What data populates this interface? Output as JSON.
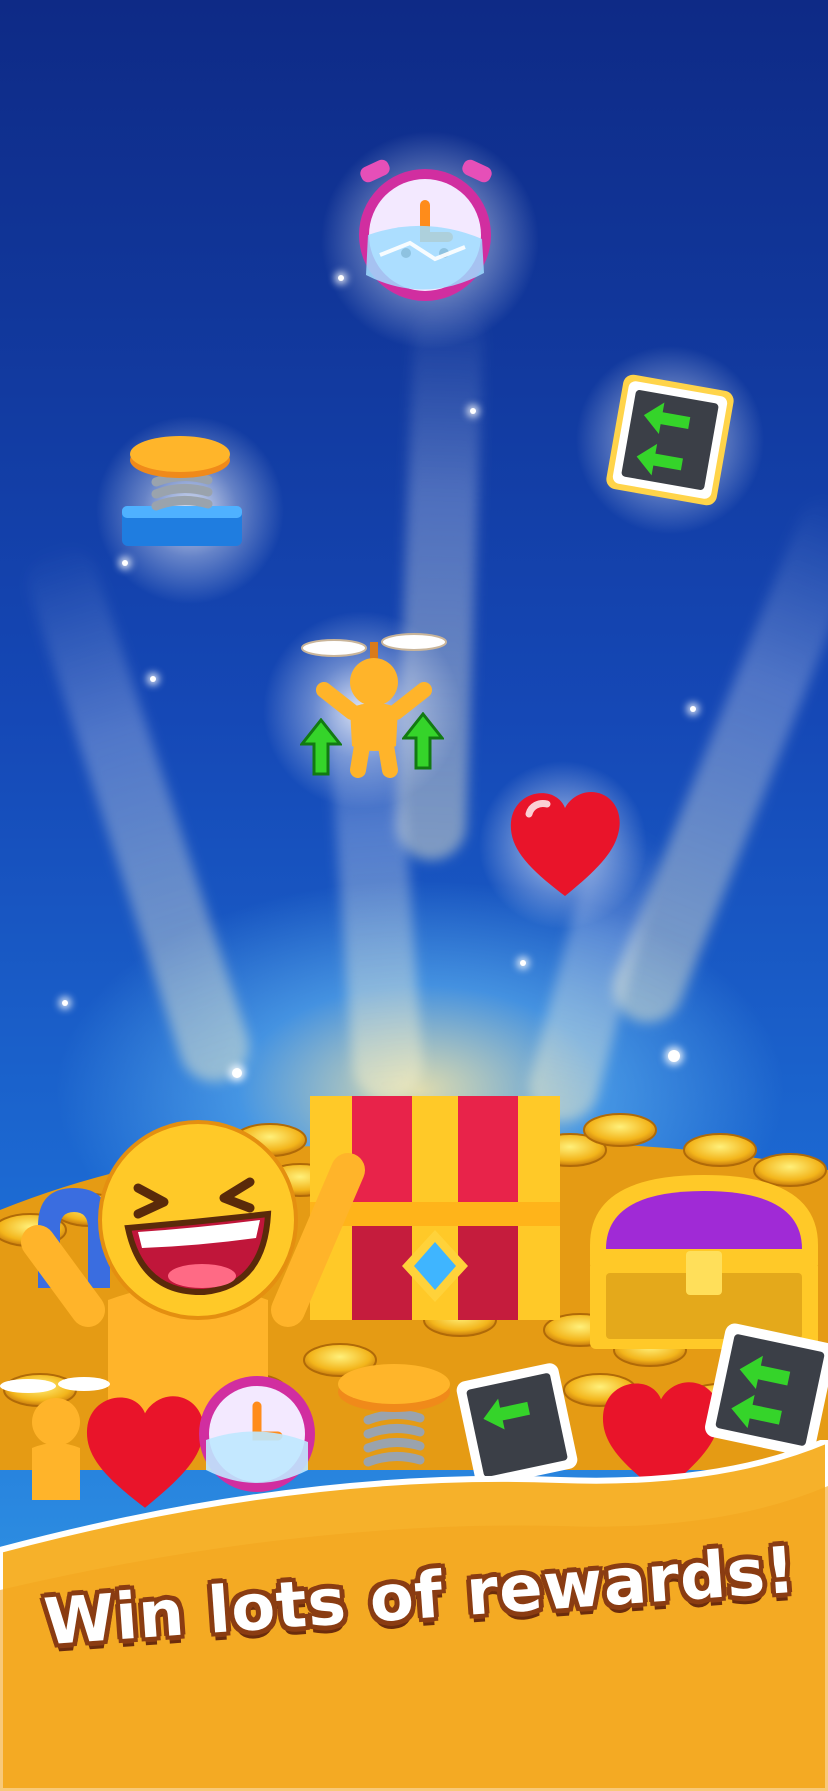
{
  "screen": {
    "banner": {
      "headline": "Win lots of rewards!"
    },
    "flying_rewards": [
      {
        "name": "freeze-clock",
        "icon": "frozen-alarm-clock-icon"
      },
      {
        "name": "undo-card",
        "icon": "double-left-arrow-card-icon"
      },
      {
        "name": "spring-booster",
        "icon": "spring-pad-icon"
      },
      {
        "name": "propeller-jump",
        "icon": "propeller-character-icon"
      },
      {
        "name": "extra-life",
        "icon": "red-heart-icon"
      }
    ],
    "treasure": {
      "icons": [
        "gold-coin-pile-icon",
        "red-treasure-chest-icon",
        "purple-treasure-chest-icon",
        "blue-magnet-icon",
        "laughing-character-icon"
      ]
    },
    "colors": {
      "sky_top": "#0e2a86",
      "sky_bottom": "#38a4ea",
      "banner": "#f6b12a",
      "banner_edge": "#ffffff",
      "text_outline": "#8a3c12"
    }
  }
}
